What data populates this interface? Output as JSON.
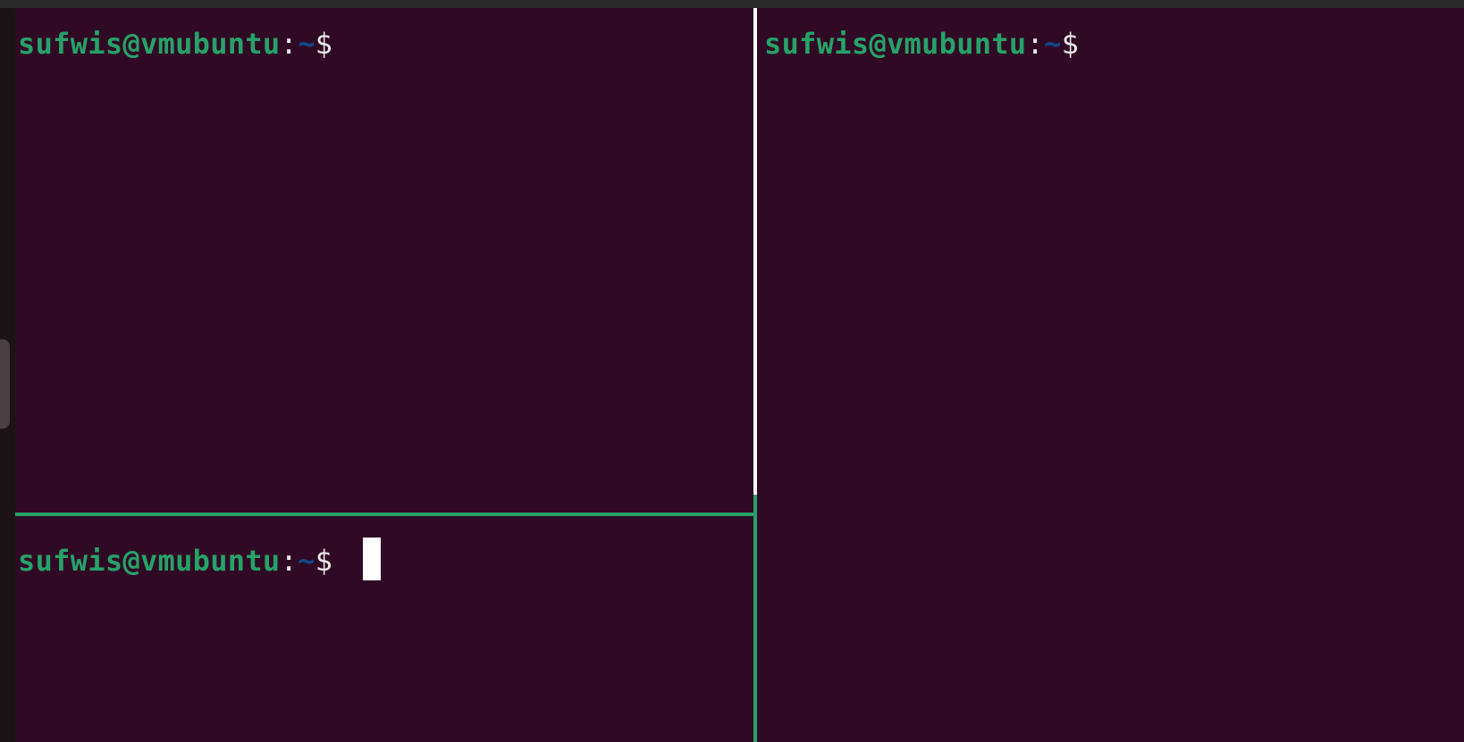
{
  "terminal": {
    "colors": {
      "background": "#300a24",
      "user_host": "#26a269",
      "path": "#12488b",
      "text": "#e8e8e8",
      "active_divider": "#26a269",
      "inactive_divider": "#ffffff"
    },
    "panes": [
      {
        "user_host": "sufwis@vmubuntu",
        "colon": ":",
        "path": "~",
        "symbol": "$"
      },
      {
        "user_host": "sufwis@vmubuntu",
        "colon": ":",
        "path": "~",
        "symbol": "$"
      },
      {
        "user_host": "sufwis@vmubuntu",
        "colon": ":",
        "path": "~",
        "symbol": "$"
      }
    ]
  }
}
